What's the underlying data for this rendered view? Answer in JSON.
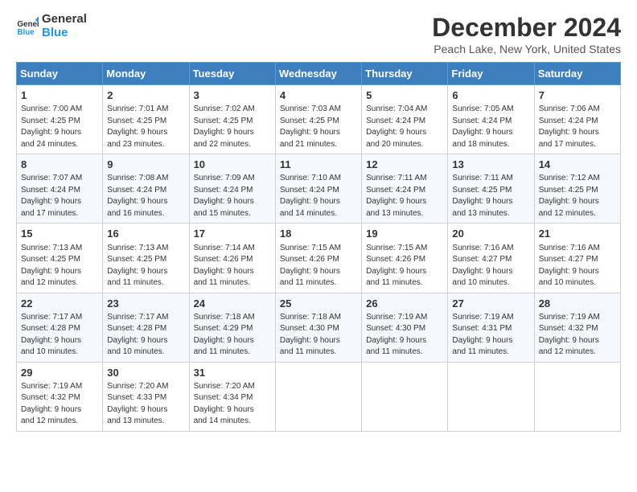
{
  "header": {
    "logo_line1": "General",
    "logo_line2": "Blue",
    "title": "December 2024",
    "subtitle": "Peach Lake, New York, United States"
  },
  "columns": [
    "Sunday",
    "Monday",
    "Tuesday",
    "Wednesday",
    "Thursday",
    "Friday",
    "Saturday"
  ],
  "weeks": [
    [
      {
        "day": "1",
        "info": "Sunrise: 7:00 AM\nSunset: 4:25 PM\nDaylight: 9 hours\nand 24 minutes."
      },
      {
        "day": "2",
        "info": "Sunrise: 7:01 AM\nSunset: 4:25 PM\nDaylight: 9 hours\nand 23 minutes."
      },
      {
        "day": "3",
        "info": "Sunrise: 7:02 AM\nSunset: 4:25 PM\nDaylight: 9 hours\nand 22 minutes."
      },
      {
        "day": "4",
        "info": "Sunrise: 7:03 AM\nSunset: 4:25 PM\nDaylight: 9 hours\nand 21 minutes."
      },
      {
        "day": "5",
        "info": "Sunrise: 7:04 AM\nSunset: 4:24 PM\nDaylight: 9 hours\nand 20 minutes."
      },
      {
        "day": "6",
        "info": "Sunrise: 7:05 AM\nSunset: 4:24 PM\nDaylight: 9 hours\nand 18 minutes."
      },
      {
        "day": "7",
        "info": "Sunrise: 7:06 AM\nSunset: 4:24 PM\nDaylight: 9 hours\nand 17 minutes."
      }
    ],
    [
      {
        "day": "8",
        "info": "Sunrise: 7:07 AM\nSunset: 4:24 PM\nDaylight: 9 hours\nand 17 minutes."
      },
      {
        "day": "9",
        "info": "Sunrise: 7:08 AM\nSunset: 4:24 PM\nDaylight: 9 hours\nand 16 minutes."
      },
      {
        "day": "10",
        "info": "Sunrise: 7:09 AM\nSunset: 4:24 PM\nDaylight: 9 hours\nand 15 minutes."
      },
      {
        "day": "11",
        "info": "Sunrise: 7:10 AM\nSunset: 4:24 PM\nDaylight: 9 hours\nand 14 minutes."
      },
      {
        "day": "12",
        "info": "Sunrise: 7:11 AM\nSunset: 4:24 PM\nDaylight: 9 hours\nand 13 minutes."
      },
      {
        "day": "13",
        "info": "Sunrise: 7:11 AM\nSunset: 4:25 PM\nDaylight: 9 hours\nand 13 minutes."
      },
      {
        "day": "14",
        "info": "Sunrise: 7:12 AM\nSunset: 4:25 PM\nDaylight: 9 hours\nand 12 minutes."
      }
    ],
    [
      {
        "day": "15",
        "info": "Sunrise: 7:13 AM\nSunset: 4:25 PM\nDaylight: 9 hours\nand 12 minutes."
      },
      {
        "day": "16",
        "info": "Sunrise: 7:13 AM\nSunset: 4:25 PM\nDaylight: 9 hours\nand 11 minutes."
      },
      {
        "day": "17",
        "info": "Sunrise: 7:14 AM\nSunset: 4:26 PM\nDaylight: 9 hours\nand 11 minutes."
      },
      {
        "day": "18",
        "info": "Sunrise: 7:15 AM\nSunset: 4:26 PM\nDaylight: 9 hours\nand 11 minutes."
      },
      {
        "day": "19",
        "info": "Sunrise: 7:15 AM\nSunset: 4:26 PM\nDaylight: 9 hours\nand 11 minutes."
      },
      {
        "day": "20",
        "info": "Sunrise: 7:16 AM\nSunset: 4:27 PM\nDaylight: 9 hours\nand 10 minutes."
      },
      {
        "day": "21",
        "info": "Sunrise: 7:16 AM\nSunset: 4:27 PM\nDaylight: 9 hours\nand 10 minutes."
      }
    ],
    [
      {
        "day": "22",
        "info": "Sunrise: 7:17 AM\nSunset: 4:28 PM\nDaylight: 9 hours\nand 10 minutes."
      },
      {
        "day": "23",
        "info": "Sunrise: 7:17 AM\nSunset: 4:28 PM\nDaylight: 9 hours\nand 10 minutes."
      },
      {
        "day": "24",
        "info": "Sunrise: 7:18 AM\nSunset: 4:29 PM\nDaylight: 9 hours\nand 11 minutes."
      },
      {
        "day": "25",
        "info": "Sunrise: 7:18 AM\nSunset: 4:30 PM\nDaylight: 9 hours\nand 11 minutes."
      },
      {
        "day": "26",
        "info": "Sunrise: 7:19 AM\nSunset: 4:30 PM\nDaylight: 9 hours\nand 11 minutes."
      },
      {
        "day": "27",
        "info": "Sunrise: 7:19 AM\nSunset: 4:31 PM\nDaylight: 9 hours\nand 11 minutes."
      },
      {
        "day": "28",
        "info": "Sunrise: 7:19 AM\nSunset: 4:32 PM\nDaylight: 9 hours\nand 12 minutes."
      }
    ],
    [
      {
        "day": "29",
        "info": "Sunrise: 7:19 AM\nSunset: 4:32 PM\nDaylight: 9 hours\nand 12 minutes."
      },
      {
        "day": "30",
        "info": "Sunrise: 7:20 AM\nSunset: 4:33 PM\nDaylight: 9 hours\nand 13 minutes."
      },
      {
        "day": "31",
        "info": "Sunrise: 7:20 AM\nSunset: 4:34 PM\nDaylight: 9 hours\nand 14 minutes."
      },
      {
        "day": "",
        "info": ""
      },
      {
        "day": "",
        "info": ""
      },
      {
        "day": "",
        "info": ""
      },
      {
        "day": "",
        "info": ""
      }
    ]
  ]
}
